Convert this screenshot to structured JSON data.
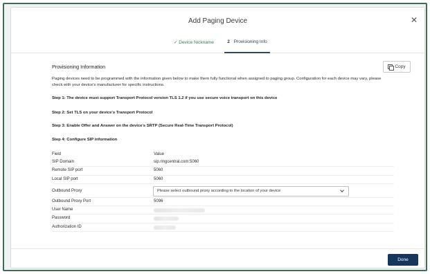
{
  "dialog": {
    "title": "Add Paging Device"
  },
  "tabs": [
    {
      "label": "Device Nickname",
      "marker": "✓"
    },
    {
      "label": "Provisioning Info",
      "marker": "2"
    }
  ],
  "section": {
    "title": "Provisioning Information",
    "copy_label": "Copy",
    "intro": "Paging devices need to be programmed with the information given below to make them fully functional when assigned to paging group. Configuration for each device may vary, please check with your device's manufacturer for specific instructions.",
    "steps": [
      "Step 1: The device must support Transport Protocol version TLS 1.2 if you use secure voice transport on this device",
      "Step 2: Set TLS on your device's Transport Protocol",
      "Step 3: Enable Offer and Answer on the device's SRTP (Secure Real-Time Transport Protocol)",
      "Step 4: Configure SIP information"
    ]
  },
  "table": {
    "headers": {
      "field": "Field",
      "value": "Value"
    },
    "rows": [
      {
        "field": "SIP Domain",
        "value": "sip.ringcentral.com:5060"
      },
      {
        "field": "Remote SIP port",
        "value": "5060"
      },
      {
        "field": "Local SIP port",
        "value": "5060"
      },
      {
        "field": "Outbound Proxy",
        "select_value": "Please select outbound proxy according to the location of your device"
      },
      {
        "field": "Outbound Proxy Port",
        "value": "5096"
      },
      {
        "field": "User Name",
        "redacted": true
      },
      {
        "field": "Password",
        "redacted": true
      },
      {
        "field": "Authorization ID",
        "redacted": true
      }
    ]
  },
  "footer": {
    "done_label": "Done"
  },
  "colors": {
    "primary": "#16365b",
    "success": "#2e7d4f",
    "frame": "#3f6b53"
  }
}
